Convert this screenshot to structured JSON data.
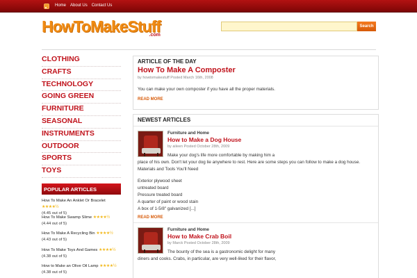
{
  "topnav": {
    "items": [
      "Home",
      "About Us",
      "Contact Us"
    ]
  },
  "header": {
    "logo_main": "HowToMakeStuff",
    "logo_sub": ".com",
    "search_placeholder": "",
    "search_button": "Search"
  },
  "categories": [
    "CLOTHING",
    "CRAFTS",
    "TECHNOLOGY",
    "GOING GREEN",
    "FURNITURE",
    "SEASONAL",
    "INSTRUMENTS",
    "OUTDOOR",
    "SPORTS",
    "TOYS"
  ],
  "popular": {
    "heading": "POPULAR ARTICLES",
    "items": [
      {
        "title": "How To Make An Anklet Or Bracelet",
        "rating": "(4.45 out of 5)",
        "stars": 4.5
      },
      {
        "title": "How To Make Swamp Slime",
        "rating": "(4.44 out of 5)",
        "stars": 4.5
      },
      {
        "title": "How To Make A Recycling Bin",
        "rating": "(4.43 out of 5)",
        "stars": 4.5
      },
      {
        "title": "How To Make Toys And Games",
        "rating": "(4.38 out of 5)",
        "stars": 4.5
      },
      {
        "title": "How to Make an Olive Oil Lamp",
        "rating": "(4.38 out of 5)",
        "stars": 4.5
      }
    ]
  },
  "article_of_day": {
    "heading": "ARTICLE OF THE DAY",
    "title": "How To Make A Composter",
    "meta": "by howtomakestuff Posted March 16th, 2008",
    "excerpt": "You can make your own composter if you have all the proper materials.",
    "readmore": "READ MORE"
  },
  "newest": {
    "heading": "NEWEST ARTICLES",
    "articles": [
      {
        "category": "Furniture and Home",
        "title": "How to Make a Dog House",
        "meta": "by aileen Posted October 28th, 2009",
        "excerpt_first": "Make your dog's life more comfortable by making him a",
        "excerpt_rest": "place of his own. Don't let your dog lie anywhere to rest. Here are some steps you can follow to make a dog house.",
        "materials_heading": "Materials and Tools You'll Need",
        "materials": [
          "Exterior plywood sheet",
          "untreated board",
          "Pressure treated board",
          "A quarter of paint or wood stain",
          "A box of 1-5/8\" galvanized [...]"
        ],
        "readmore": "READ MORE"
      },
      {
        "category": "Furniture and Home",
        "title": "How to Make Crab Boil",
        "meta": "by Marck Posted October 28th, 2009",
        "excerpt_first": "The bounty of the sea is a gastronomic delight for many",
        "excerpt_rest": "diners and cooks. Crabs, in particular, are very well-liked for their flavor,"
      }
    ]
  }
}
